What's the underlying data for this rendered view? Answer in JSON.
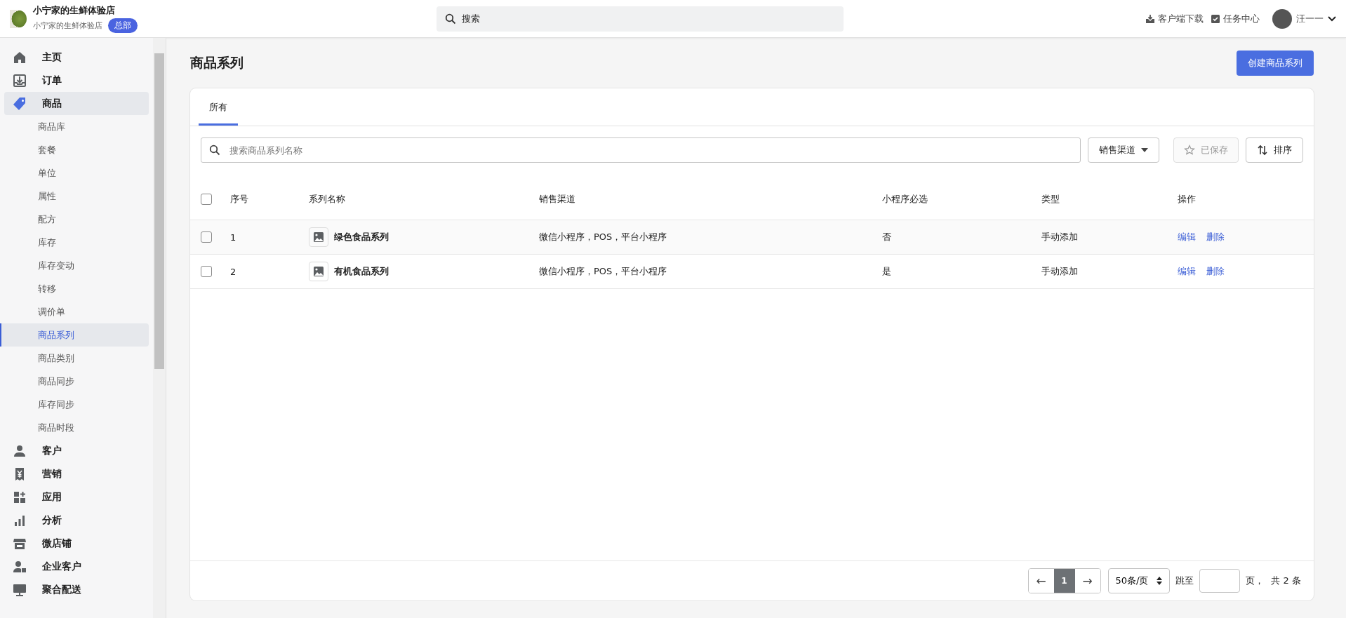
{
  "header": {
    "store_name": "小宁家的生鲜体验店",
    "store_sub": "小宁家的生鲜体验店",
    "store_badge": "总部",
    "search": {
      "placeholder": "搜索"
    },
    "links": [
      "客户端下载",
      "任务中心"
    ],
    "user": "汪一一"
  },
  "sidebar": {
    "items": [
      {
        "label": "主页",
        "selected": false
      },
      {
        "label": "订单",
        "selected": false
      },
      {
        "label": "商品",
        "selected": true,
        "children": [
          {
            "label": "商品库",
            "selected": false
          },
          {
            "label": "套餐",
            "selected": false
          },
          {
            "label": "单位",
            "selected": false
          },
          {
            "label": "属性",
            "selected": false
          },
          {
            "label": "配方",
            "selected": false
          },
          {
            "label": "库存",
            "selected": false
          },
          {
            "label": "库存变动",
            "selected": false
          },
          {
            "label": "转移",
            "selected": false
          },
          {
            "label": "调价单",
            "selected": false
          },
          {
            "label": "商品系列",
            "selected": true
          },
          {
            "label": "商品类别",
            "selected": false
          },
          {
            "label": "商品同步",
            "selected": false
          },
          {
            "label": "库存同步",
            "selected": false
          },
          {
            "label": "商品时段",
            "selected": false
          }
        ]
      },
      {
        "label": "客户",
        "selected": false
      },
      {
        "label": "营销",
        "selected": false
      },
      {
        "label": "应用",
        "selected": false
      },
      {
        "label": "分析",
        "selected": false
      },
      {
        "label": "微店铺",
        "selected": false
      },
      {
        "label": "企业客户",
        "selected": false
      },
      {
        "label": "聚合配送",
        "selected": false
      }
    ]
  },
  "page": {
    "title": "商品系列",
    "create_button": "创建商品系列"
  },
  "tabs": [
    {
      "label": "所有",
      "selected": true
    }
  ],
  "toolbar": {
    "search": {
      "placeholder": "搜索商品系列名称"
    },
    "channel_filter": "销售渠道",
    "saved_button": {
      "label": "已保存",
      "disabled": true
    },
    "sort_button": "排序"
  },
  "table": {
    "all_checked": false,
    "columns": [
      "序号",
      "系列名称",
      "销售渠道",
      "小程序必选",
      "类型",
      "操作"
    ],
    "rows": [
      {
        "checked": false,
        "no": "1",
        "name": "绿色食品系列",
        "channels": "微信小程序，POS，平台小程序",
        "required": "否",
        "type": "手动添加",
        "actions": [
          "编辑",
          "删除"
        ]
      },
      {
        "checked": false,
        "no": "2",
        "name": "有机食品系列",
        "channels": "微信小程序，POS，平台小程序",
        "required": "是",
        "type": "手动添加",
        "actions": [
          "编辑",
          "删除"
        ]
      }
    ]
  },
  "pagination": {
    "prev": "←",
    "page": "1",
    "next": "→",
    "page_size": "50条/页",
    "jump_label": "跳至",
    "page_unit": "页，",
    "total": "共 2 条"
  }
}
